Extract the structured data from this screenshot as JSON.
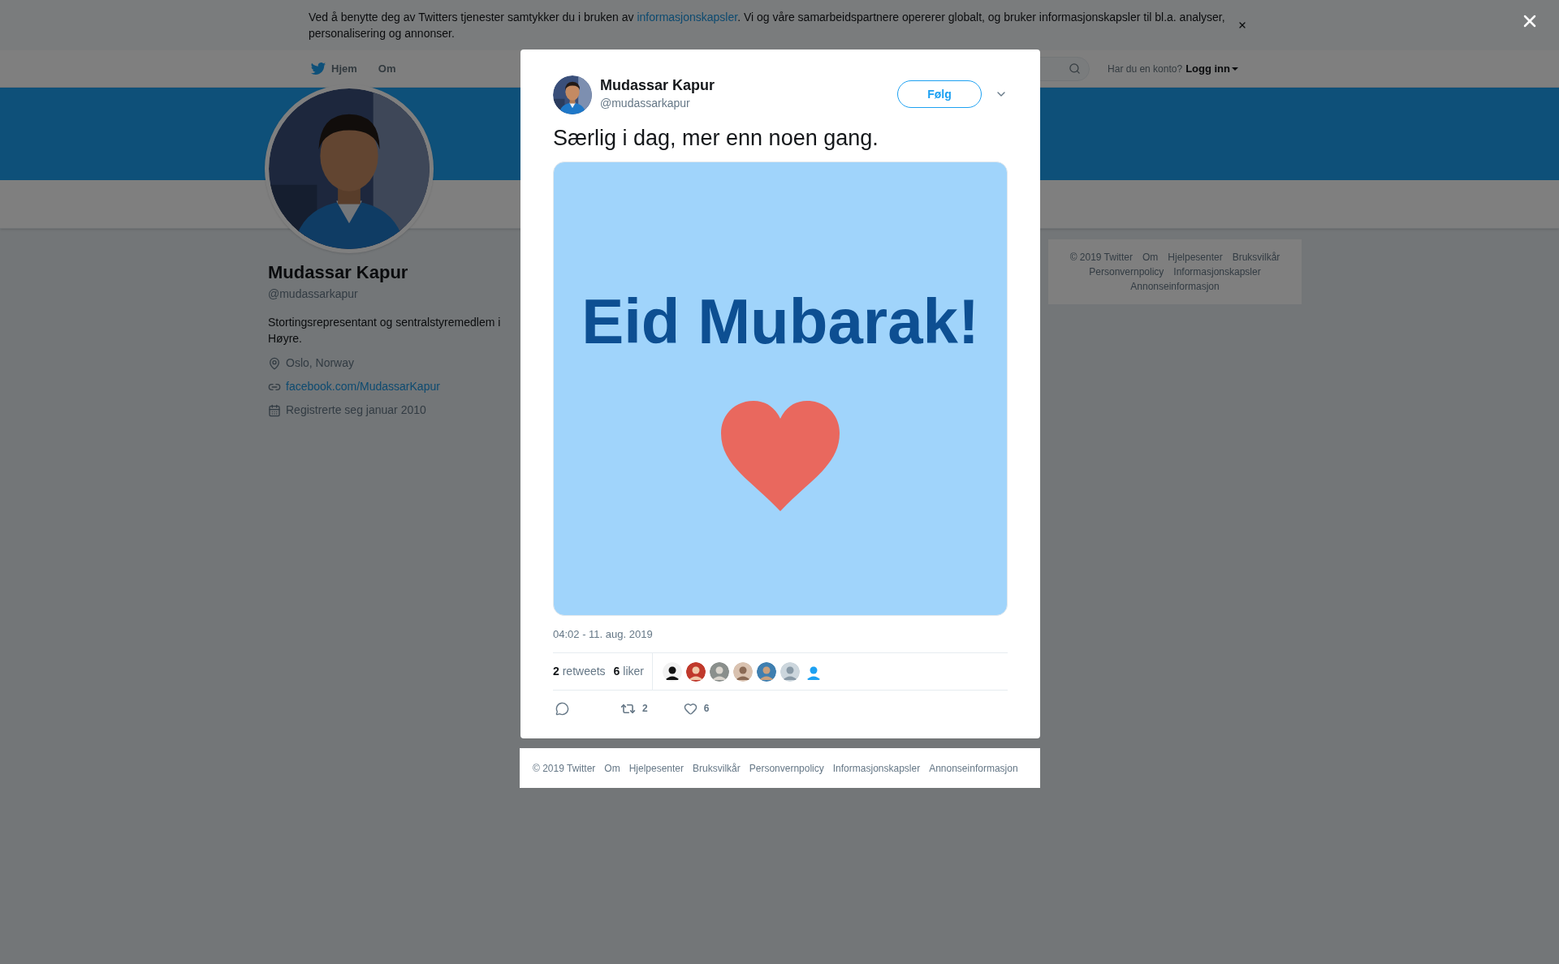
{
  "cookie_banner": {
    "text": "Ved å benytte deg av Twitters tjenester samtykker du i bruken av",
    "link": "informasjonskapsler",
    "text_after": ". Vi og våre samarbeidspartnere opererer globalt, og bruker informasjonskapsler til bl.a. analyser, personalisering og annonser."
  },
  "nav": {
    "items": [
      {
        "label": "Hjem",
        "kind": "home"
      },
      {
        "label": "Om",
        "kind": "plain"
      }
    ],
    "account_prompt": "Har du en konto?",
    "login": "Logg inn"
  },
  "profile": {
    "name": "Mudassar Kapur",
    "handle": "@mudassarkapur",
    "bio": "Stortingsrepresentant og sentralstyremedlem i Høyre.",
    "location": "Oslo, Norway",
    "website": "facebook.com/MudassarKapur",
    "joined": "Registrerte seg januar 2010"
  },
  "sidebar_footer": {
    "links": [
      "© 2019 Twitter",
      "Om",
      "Hjelpesenter",
      "Bruksvilkår",
      "Personvernpolicy",
      "Informasjonskapsler",
      "Annonseinformasjon"
    ]
  },
  "tweet": {
    "author_name": "Mudassar Kapur",
    "author_handle": "@mudassarkapur",
    "follow_button": "Følg",
    "text": "Særlig i dag, mer enn noen gang.",
    "media": {
      "headline": "Eid Mubarak!"
    },
    "timestamp": "04:02 - 11. aug. 2019",
    "retweets": {
      "count": "2",
      "label": "retweets"
    },
    "likes": {
      "count": "6",
      "label": "liker"
    },
    "actions": {
      "retweet_count": "2",
      "like_count": "6"
    }
  },
  "modal_footer": {
    "links": [
      "© 2019 Twitter",
      "Om",
      "Hjelpesenter",
      "Bruksvilkår",
      "Personvernpolicy",
      "Informasjonskapsler",
      "Annonseinformasjon"
    ]
  }
}
